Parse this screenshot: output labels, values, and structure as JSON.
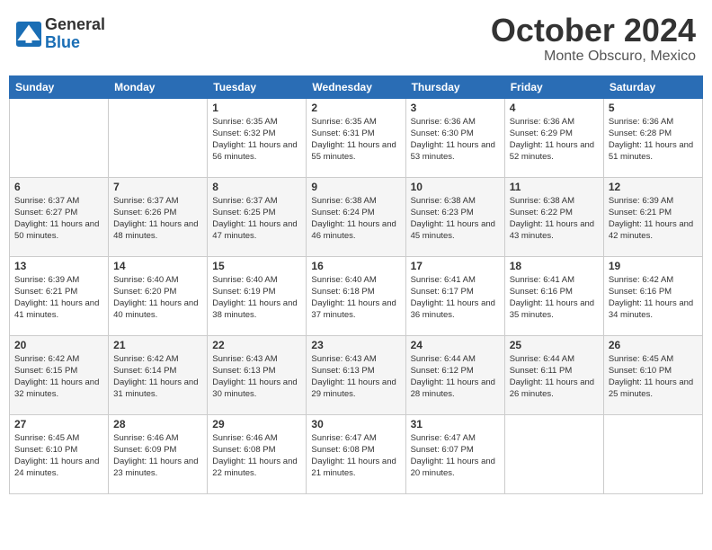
{
  "header": {
    "logo_general": "General",
    "logo_blue": "Blue",
    "month": "October 2024",
    "location": "Monte Obscuro, Mexico"
  },
  "days_of_week": [
    "Sunday",
    "Monday",
    "Tuesday",
    "Wednesday",
    "Thursday",
    "Friday",
    "Saturday"
  ],
  "weeks": [
    [
      {
        "day": "",
        "info": ""
      },
      {
        "day": "",
        "info": ""
      },
      {
        "day": "1",
        "info": "Sunrise: 6:35 AM\nSunset: 6:32 PM\nDaylight: 11 hours and 56 minutes."
      },
      {
        "day": "2",
        "info": "Sunrise: 6:35 AM\nSunset: 6:31 PM\nDaylight: 11 hours and 55 minutes."
      },
      {
        "day": "3",
        "info": "Sunrise: 6:36 AM\nSunset: 6:30 PM\nDaylight: 11 hours and 53 minutes."
      },
      {
        "day": "4",
        "info": "Sunrise: 6:36 AM\nSunset: 6:29 PM\nDaylight: 11 hours and 52 minutes."
      },
      {
        "day": "5",
        "info": "Sunrise: 6:36 AM\nSunset: 6:28 PM\nDaylight: 11 hours and 51 minutes."
      }
    ],
    [
      {
        "day": "6",
        "info": "Sunrise: 6:37 AM\nSunset: 6:27 PM\nDaylight: 11 hours and 50 minutes."
      },
      {
        "day": "7",
        "info": "Sunrise: 6:37 AM\nSunset: 6:26 PM\nDaylight: 11 hours and 48 minutes."
      },
      {
        "day": "8",
        "info": "Sunrise: 6:37 AM\nSunset: 6:25 PM\nDaylight: 11 hours and 47 minutes."
      },
      {
        "day": "9",
        "info": "Sunrise: 6:38 AM\nSunset: 6:24 PM\nDaylight: 11 hours and 46 minutes."
      },
      {
        "day": "10",
        "info": "Sunrise: 6:38 AM\nSunset: 6:23 PM\nDaylight: 11 hours and 45 minutes."
      },
      {
        "day": "11",
        "info": "Sunrise: 6:38 AM\nSunset: 6:22 PM\nDaylight: 11 hours and 43 minutes."
      },
      {
        "day": "12",
        "info": "Sunrise: 6:39 AM\nSunset: 6:21 PM\nDaylight: 11 hours and 42 minutes."
      }
    ],
    [
      {
        "day": "13",
        "info": "Sunrise: 6:39 AM\nSunset: 6:21 PM\nDaylight: 11 hours and 41 minutes."
      },
      {
        "day": "14",
        "info": "Sunrise: 6:40 AM\nSunset: 6:20 PM\nDaylight: 11 hours and 40 minutes."
      },
      {
        "day": "15",
        "info": "Sunrise: 6:40 AM\nSunset: 6:19 PM\nDaylight: 11 hours and 38 minutes."
      },
      {
        "day": "16",
        "info": "Sunrise: 6:40 AM\nSunset: 6:18 PM\nDaylight: 11 hours and 37 minutes."
      },
      {
        "day": "17",
        "info": "Sunrise: 6:41 AM\nSunset: 6:17 PM\nDaylight: 11 hours and 36 minutes."
      },
      {
        "day": "18",
        "info": "Sunrise: 6:41 AM\nSunset: 6:16 PM\nDaylight: 11 hours and 35 minutes."
      },
      {
        "day": "19",
        "info": "Sunrise: 6:42 AM\nSunset: 6:16 PM\nDaylight: 11 hours and 34 minutes."
      }
    ],
    [
      {
        "day": "20",
        "info": "Sunrise: 6:42 AM\nSunset: 6:15 PM\nDaylight: 11 hours and 32 minutes."
      },
      {
        "day": "21",
        "info": "Sunrise: 6:42 AM\nSunset: 6:14 PM\nDaylight: 11 hours and 31 minutes."
      },
      {
        "day": "22",
        "info": "Sunrise: 6:43 AM\nSunset: 6:13 PM\nDaylight: 11 hours and 30 minutes."
      },
      {
        "day": "23",
        "info": "Sunrise: 6:43 AM\nSunset: 6:13 PM\nDaylight: 11 hours and 29 minutes."
      },
      {
        "day": "24",
        "info": "Sunrise: 6:44 AM\nSunset: 6:12 PM\nDaylight: 11 hours and 28 minutes."
      },
      {
        "day": "25",
        "info": "Sunrise: 6:44 AM\nSunset: 6:11 PM\nDaylight: 11 hours and 26 minutes."
      },
      {
        "day": "26",
        "info": "Sunrise: 6:45 AM\nSunset: 6:10 PM\nDaylight: 11 hours and 25 minutes."
      }
    ],
    [
      {
        "day": "27",
        "info": "Sunrise: 6:45 AM\nSunset: 6:10 PM\nDaylight: 11 hours and 24 minutes."
      },
      {
        "day": "28",
        "info": "Sunrise: 6:46 AM\nSunset: 6:09 PM\nDaylight: 11 hours and 23 minutes."
      },
      {
        "day": "29",
        "info": "Sunrise: 6:46 AM\nSunset: 6:08 PM\nDaylight: 11 hours and 22 minutes."
      },
      {
        "day": "30",
        "info": "Sunrise: 6:47 AM\nSunset: 6:08 PM\nDaylight: 11 hours and 21 minutes."
      },
      {
        "day": "31",
        "info": "Sunrise: 6:47 AM\nSunset: 6:07 PM\nDaylight: 11 hours and 20 minutes."
      },
      {
        "day": "",
        "info": ""
      },
      {
        "day": "",
        "info": ""
      }
    ]
  ]
}
